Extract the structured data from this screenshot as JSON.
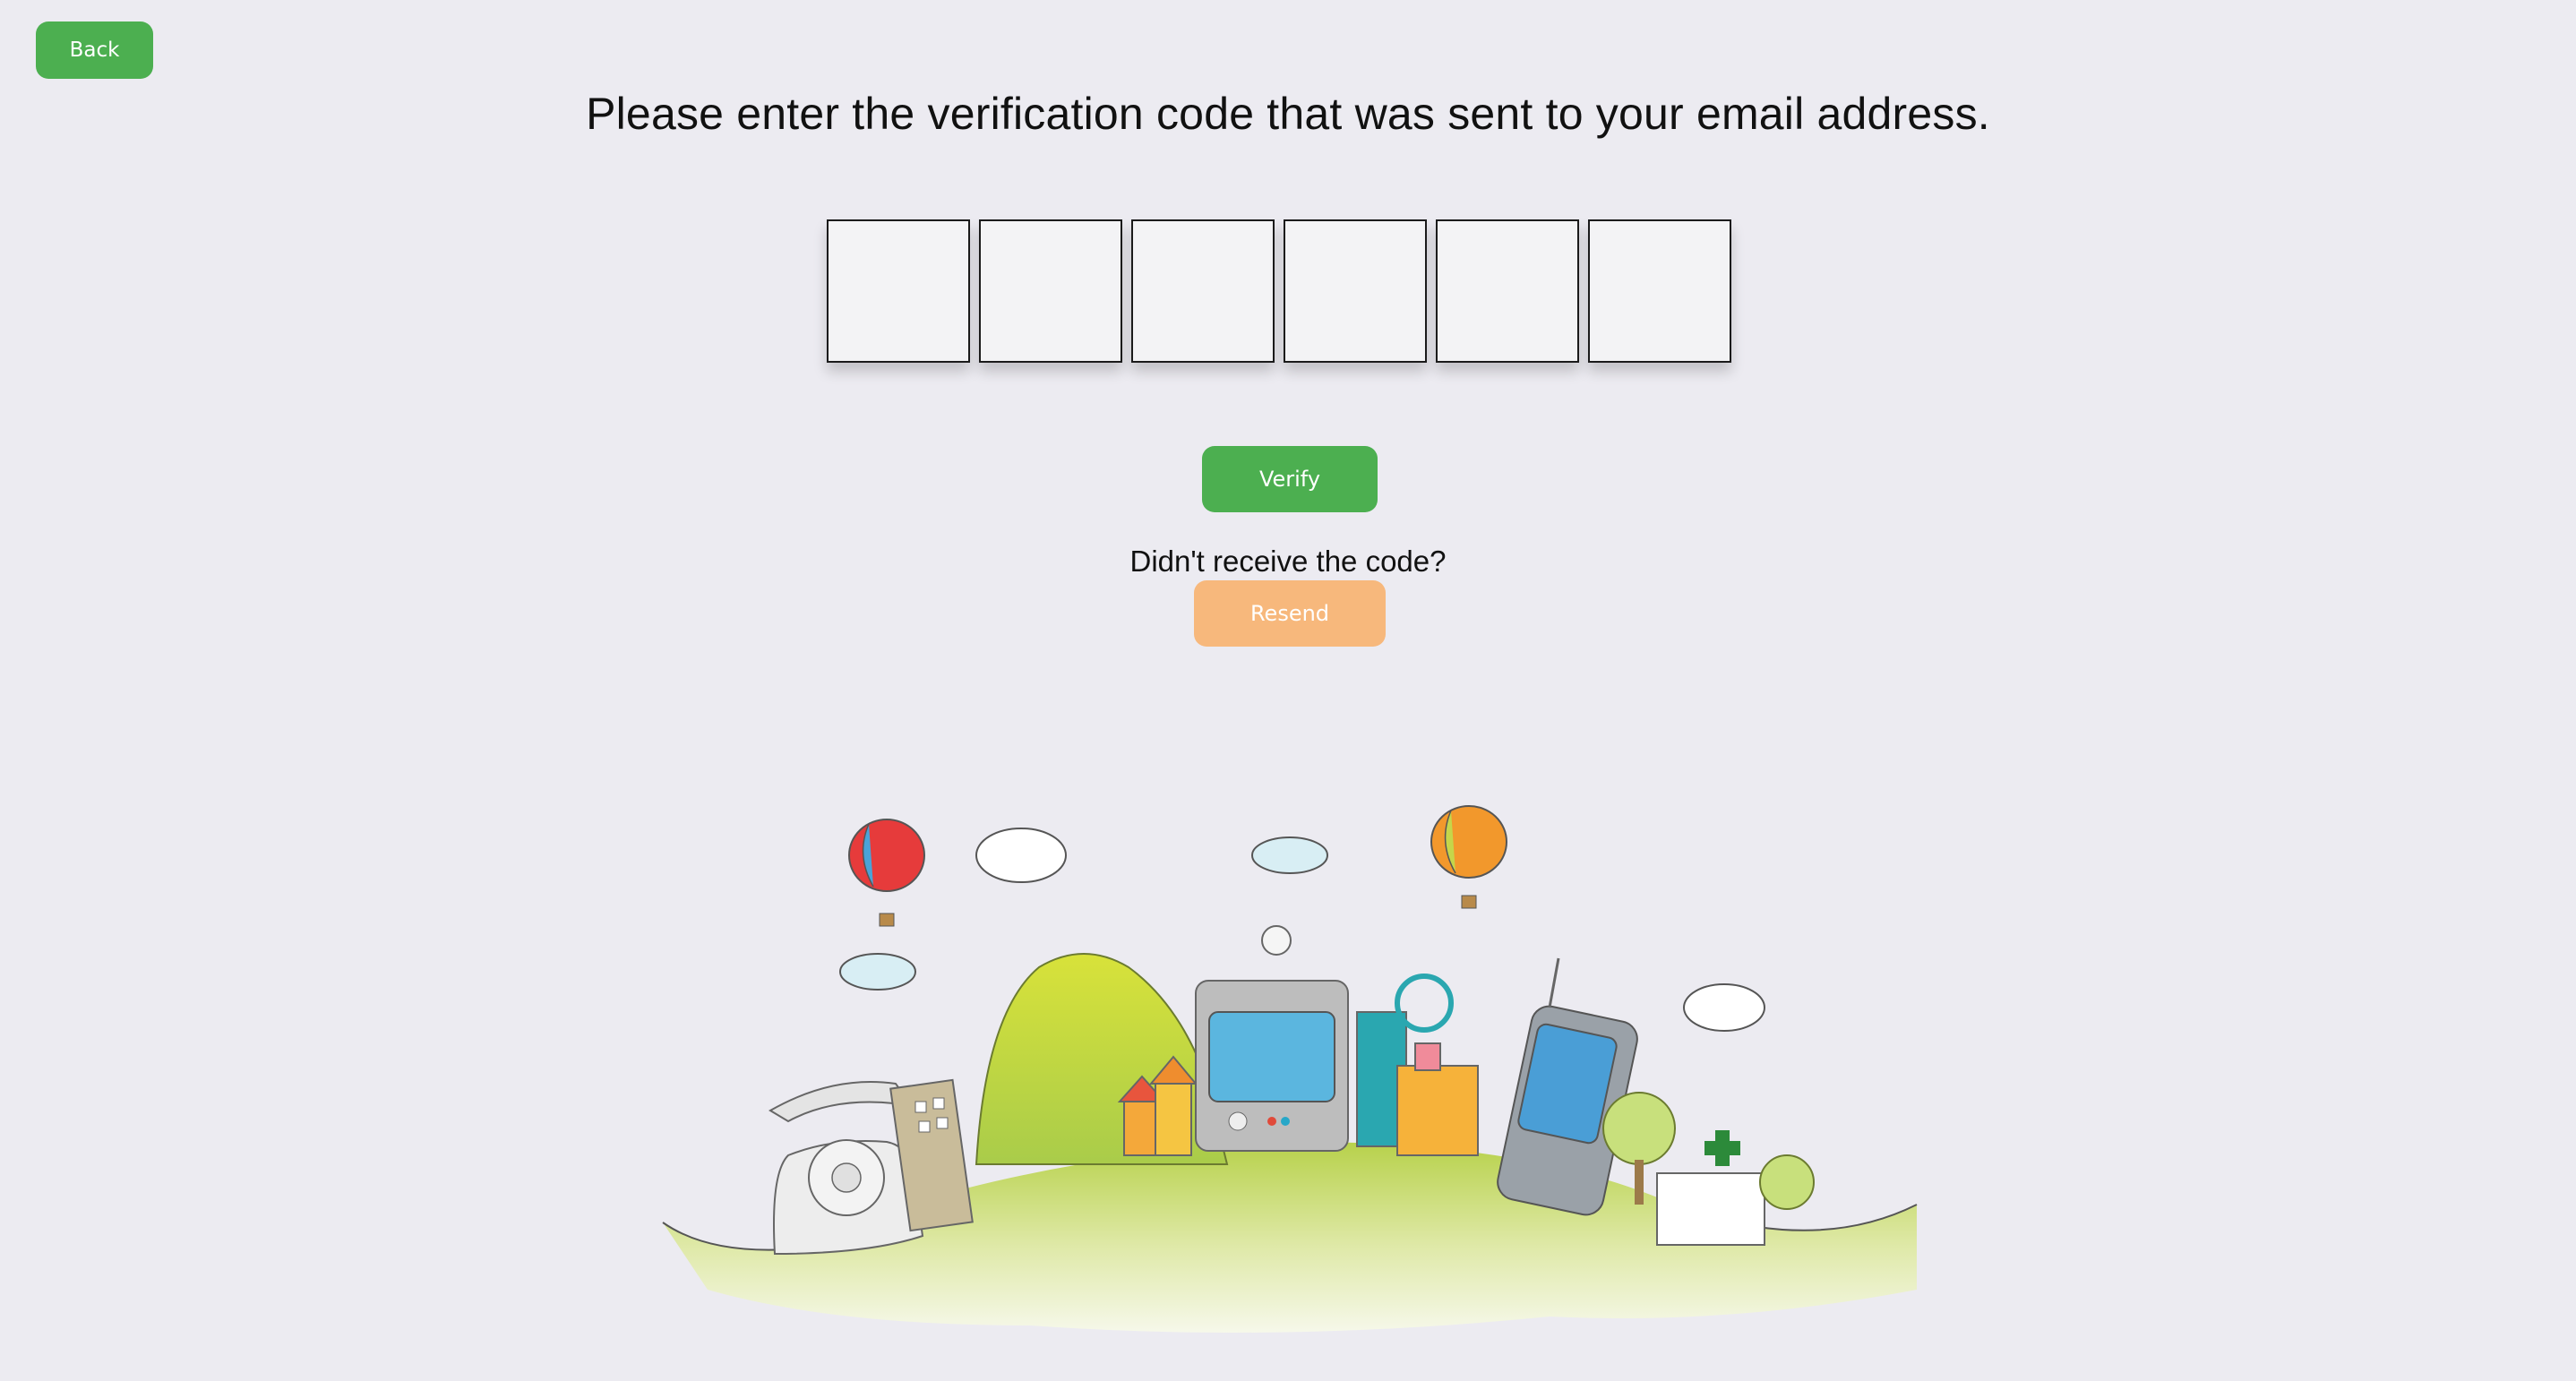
{
  "header": {
    "back_label": "Back",
    "title": "Please enter the verification code that was sent to your email address."
  },
  "code_inputs": [
    {
      "value": ""
    },
    {
      "value": ""
    },
    {
      "value": ""
    },
    {
      "value": ""
    },
    {
      "value": ""
    },
    {
      "value": ""
    }
  ],
  "actions": {
    "verify_label": "Verify",
    "resend_prompt": "Didn't receive the code?",
    "resend_label": "Resend"
  },
  "colors": {
    "background": "#ecebf1",
    "primary_button": "#4caf50",
    "secondary_button": "#f7b87c"
  },
  "illustration": {
    "name": "city-landscape-illustration"
  }
}
